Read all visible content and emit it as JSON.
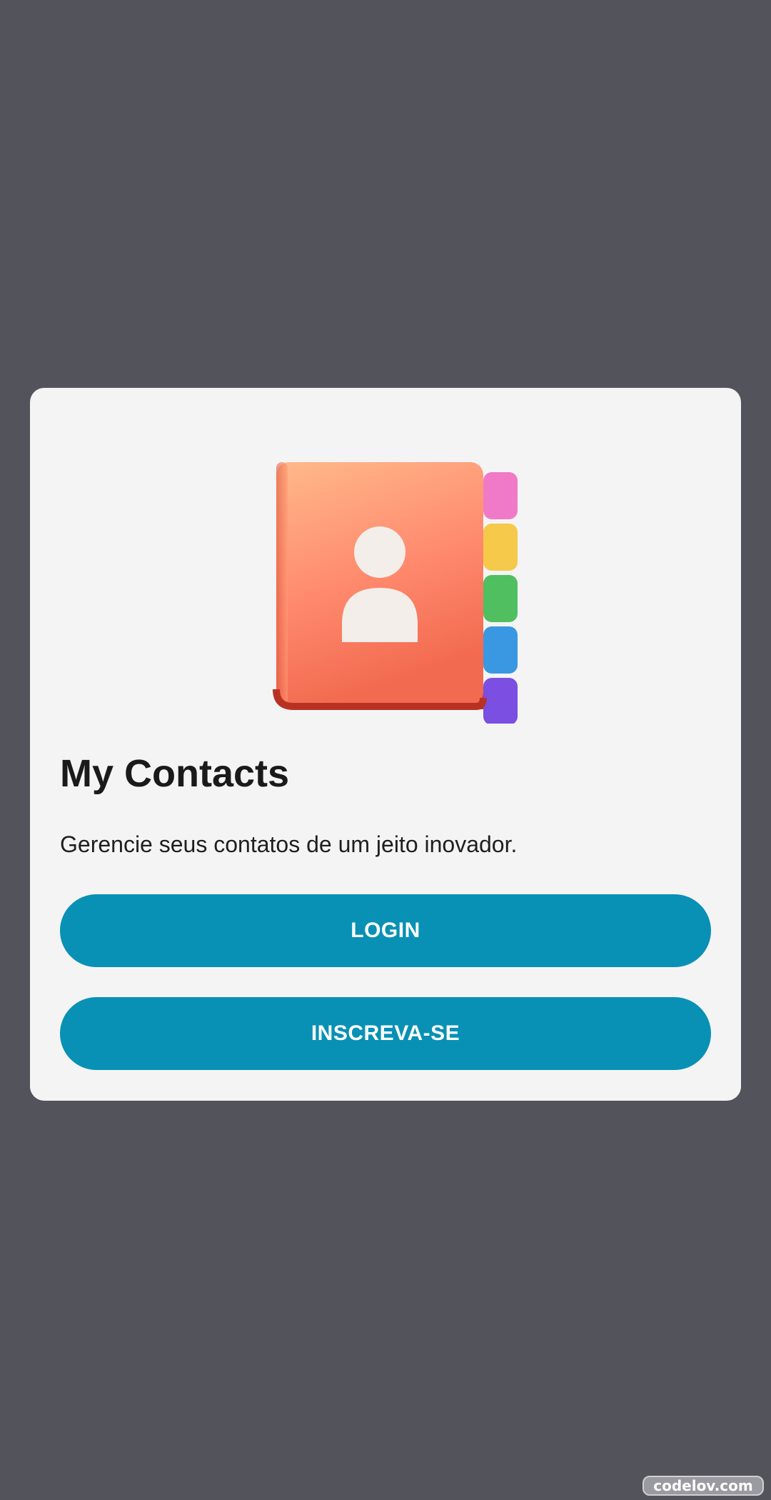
{
  "card": {
    "title": "My Contacts",
    "subtitle": "Gerencie seus contatos de um jeito inovador.",
    "login_label": "LOGIN",
    "signup_label": "INSCREVA-SE",
    "illustration_icon": "address-book-icon"
  },
  "watermark": {
    "text": "codelov.com"
  },
  "colors": {
    "background": "#53535c",
    "card": "#f4f4f4",
    "button": "#0891b4",
    "button_text": "#ffffff",
    "title": "#1a1a1a"
  }
}
